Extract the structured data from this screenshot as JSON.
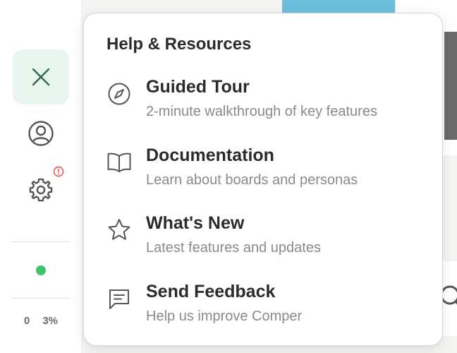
{
  "sidebar": {
    "close_icon": "close-icon",
    "profile_icon": "user-circle-icon",
    "settings_icon": "gear-icon",
    "alert_icon": "alert-circle-icon",
    "status_color": "#3ec46d",
    "stat_count": "0",
    "stat_percent": "3%"
  },
  "popover": {
    "title": "Help & Resources",
    "items": [
      {
        "icon": "compass-icon",
        "title": "Guided Tour",
        "description": "2-minute walkthrough of key features"
      },
      {
        "icon": "book-open-icon",
        "title": "Documentation",
        "description": "Learn about boards and personas"
      },
      {
        "icon": "star-icon",
        "title": "What's New",
        "description": "Latest features and updates"
      },
      {
        "icon": "message-square-icon",
        "title": "Send Feedback",
        "description": "Help us improve Comper"
      }
    ]
  },
  "colors": {
    "accent": "#2f6b4a",
    "active_bg": "#e8f4ee",
    "alert": "#e04848"
  }
}
